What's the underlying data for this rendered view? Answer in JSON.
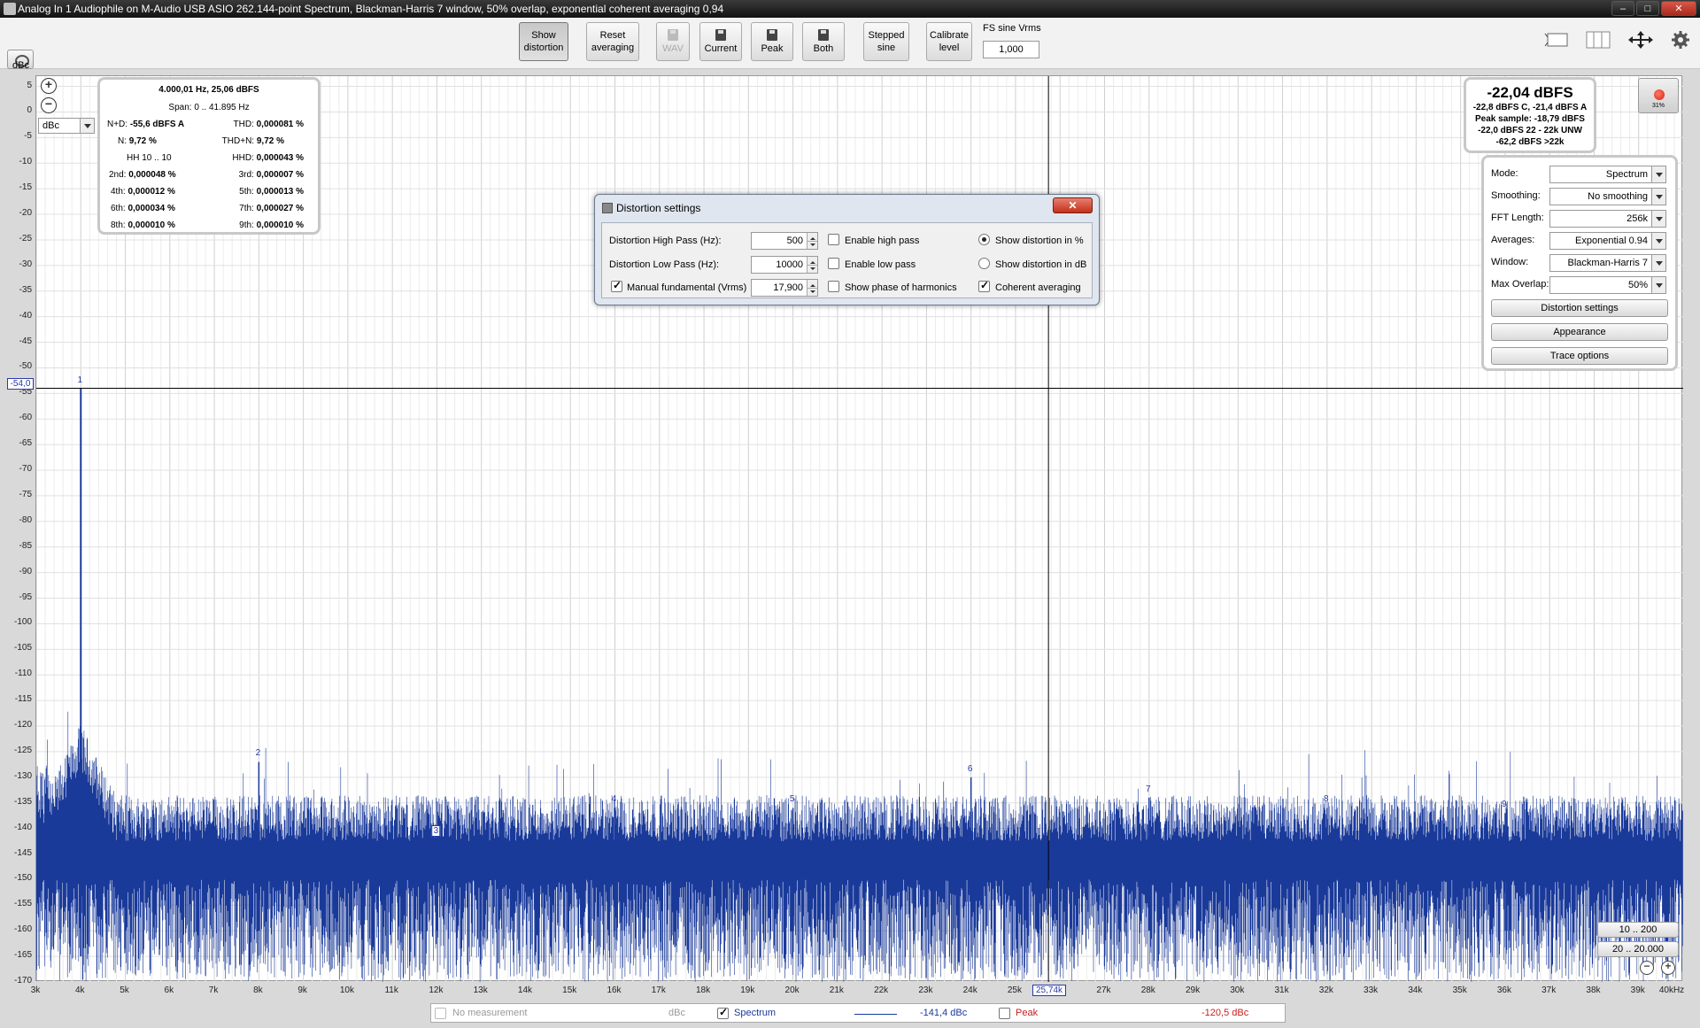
{
  "window": {
    "title": "Analog In 1 Audiophile on M-Audio USB ASIO 262.144-point Spectrum, Blackman-Harris 7 window, 50% overlap, exponential coherent averaging 0,94",
    "min_label": "–",
    "max_label": "□",
    "close_label": "✕"
  },
  "toolbar": {
    "show_distortion": [
      "Show",
      "distortion"
    ],
    "reset_averaging": [
      "Reset",
      "averaging"
    ],
    "wav": "WAV",
    "current": "Current",
    "peak": "Peak",
    "both": "Both",
    "stepped_sine": [
      "Stepped",
      "sine"
    ],
    "calibrate_level": [
      "Calibrate",
      "level"
    ],
    "fs_label": "FS sine Vrms",
    "fs_value": "1,000"
  },
  "plot": {
    "y_unit": "dBc",
    "unit_select": "dBc",
    "y_ticks": [
      "5",
      "0",
      "-5",
      "-10",
      "-15",
      "-20",
      "-25",
      "-30",
      "-35",
      "-40",
      "-45",
      "-50",
      "-55",
      "-60",
      "-65",
      "-70",
      "-75",
      "-80",
      "-85",
      "-90",
      "-95",
      "-100",
      "-105",
      "-110",
      "-115",
      "-120",
      "-125",
      "-130",
      "-135",
      "-140",
      "-145",
      "-150",
      "-155",
      "-160",
      "-165",
      "-170"
    ],
    "x_ticks": [
      "3k",
      "4k",
      "5k",
      "6k",
      "7k",
      "8k",
      "9k",
      "10k",
      "11k",
      "12k",
      "13k",
      "14k",
      "15k",
      "16k",
      "17k",
      "18k",
      "19k",
      "20k",
      "21k",
      "22k",
      "23k",
      "24k",
      "25k",
      "26k",
      "27k",
      "28k",
      "29k",
      "30k",
      "31k",
      "32k",
      "33k",
      "34k",
      "35k",
      "36k",
      "37k",
      "38k",
      "39k",
      "40kHz"
    ],
    "cursor_y": "-54,0",
    "cursor_x": "25,74k",
    "harmonic_labels": [
      "1",
      "2",
      "3",
      "4",
      "5",
      "6",
      "7",
      "8",
      "9"
    ]
  },
  "stats": {
    "header": "4.000,01 Hz, 25,06 dBFS",
    "span": "Span: 0 .. 41.895 Hz",
    "nd_label": "N+D:",
    "nd_value": "-55,6 dBFS A",
    "thd_label": "THD:",
    "thd_value": "0,000081 %",
    "n_label": "N:",
    "n_value": "9,72 %",
    "thdn_label": "THD+N:",
    "thdn_value": "9,72 %",
    "hh_label": "HH 10 .. 10",
    "hhd_label": "HHD:",
    "hhd_value": "0,000043 %",
    "h2_label": "2nd:",
    "h2_value": "0,000048 %",
    "h3_label": "3rd:",
    "h3_value": "0,000007 %",
    "h4_label": "4th:",
    "h4_value": "0,000012 %",
    "h5_label": "5th:",
    "h5_value": "0,000013 %",
    "h6_label": "6th:",
    "h6_value": "0,000034 %",
    "h7_label": "7th:",
    "h7_value": "0,000027 %",
    "h8_label": "8th:",
    "h8_value": "0,000010 %",
    "h9_label": "9th:",
    "h9_value": "0,000010 %"
  },
  "level": {
    "main": "-22,04 dBFS",
    "line1": "-22,8 dBFS C, -21,4 dBFS A",
    "line2": "Peak sample: -18,79 dBFS",
    "line3": "-22,0 dBFS 22 - 22k UNW",
    "line4": "-62,2 dBFS >22k",
    "rec_pct": "31%"
  },
  "controls": {
    "mode_label": "Mode:",
    "mode_value": "Spectrum",
    "smoothing_label": "Smoothing:",
    "smoothing_value": "No  smoothing",
    "fft_label": "FFT Length:",
    "fft_value": "256k",
    "averages_label": "Averages:",
    "averages_value": "Exponential 0.94",
    "window_label": "Window:",
    "window_value": "Blackman-Harris 7",
    "overlap_label": "Max Overlap:",
    "overlap_value": "50%",
    "distortion_settings": "Distortion settings",
    "appearance": "Appearance",
    "trace_options": "Trace options"
  },
  "ranges": {
    "r1": "10 .. 200",
    "r2": "20 .. 20.000"
  },
  "dialog": {
    "title": "Distortion settings",
    "close": "✕",
    "hp_label": "Distortion High Pass (Hz):",
    "hp_value": "500",
    "lp_label": "Distortion Low Pass (Hz):",
    "lp_value": "10000",
    "mf_label": "Manual fundamental (Vrms)",
    "mf_value": "17,900",
    "enable_hp": "Enable high pass",
    "enable_lp": "Enable low pass",
    "show_phase": "Show phase of harmonics",
    "show_pct": "Show distortion in %",
    "show_db": "Show distortion in dB",
    "coherent": "Coherent averaging"
  },
  "legend": {
    "no_measurement": "No measurement",
    "no_measurement_unit": "dBc",
    "spectrum": "Spectrum",
    "spectrum_value": "-141,4 dBc",
    "peak": "Peak",
    "peak_value": "-120,5 dBc"
  },
  "colors": {
    "trace": "#1a3a9a",
    "accent": "#2a3aa8"
  },
  "chart_data": {
    "type": "line",
    "xlabel": "",
    "ylabel": "dBc",
    "xlim": [
      3000,
      40000
    ],
    "ylim": [
      -170,
      5
    ],
    "grid": true,
    "series": [
      {
        "name": "Spectrum",
        "x": [
          4000
        ],
        "values": [
          -54
        ]
      }
    ],
    "harmonics": [
      {
        "label": "1",
        "x": 4000,
        "y": -54
      },
      {
        "label": "2",
        "x": 8000,
        "y": -127
      },
      {
        "label": "3",
        "x": 12000,
        "y": -142
      },
      {
        "label": "4",
        "x": 16000,
        "y": -136
      },
      {
        "label": "5",
        "x": 20000,
        "y": -136
      },
      {
        "label": "6",
        "x": 24000,
        "y": -130
      },
      {
        "label": "7",
        "x": 28000,
        "y": -134
      },
      {
        "label": "8",
        "x": 32000,
        "y": -136
      },
      {
        "label": "9",
        "x": 36000,
        "y": -137
      }
    ],
    "noise_floor": [
      -170,
      -133
    ]
  }
}
